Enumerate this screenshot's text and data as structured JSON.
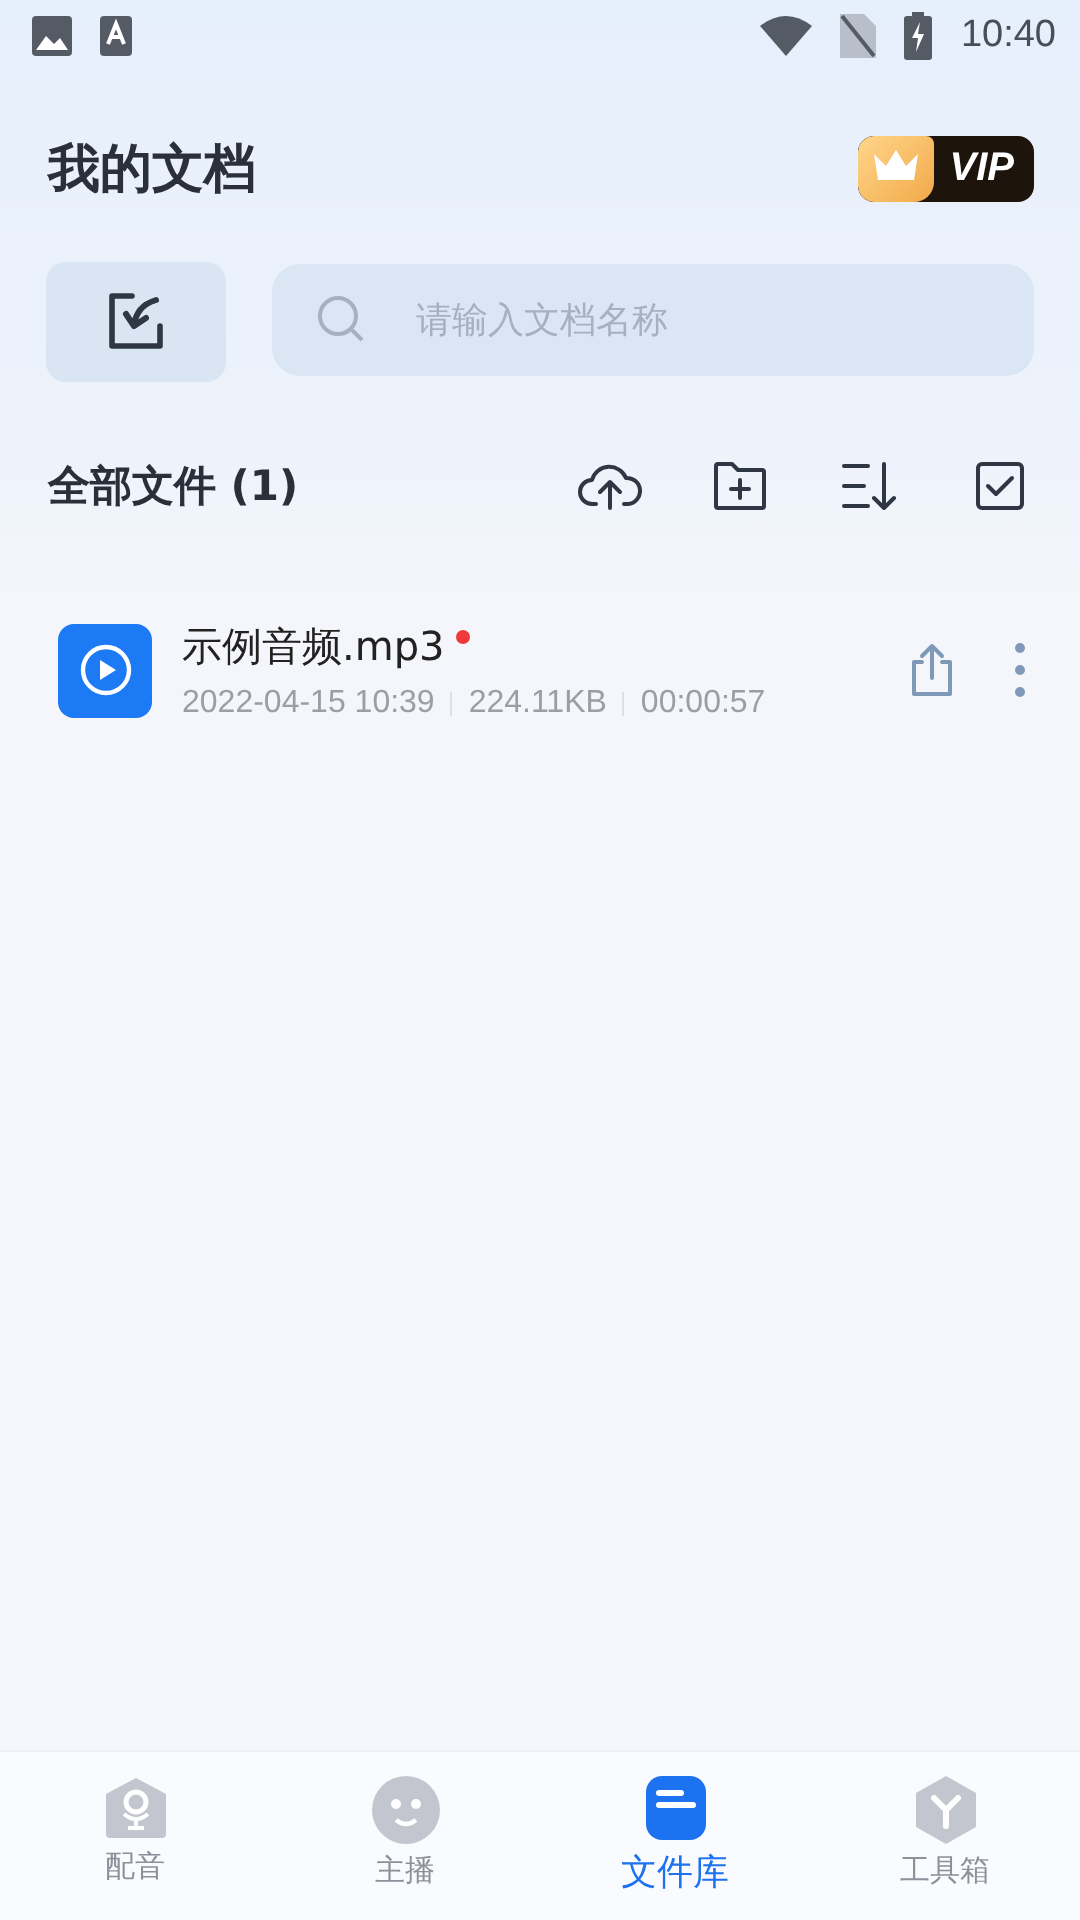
{
  "status_bar": {
    "time": "10:40"
  },
  "header": {
    "title": "我的文档",
    "vip_badge": "VIP"
  },
  "search": {
    "placeholder": "请输入文档名称"
  },
  "section": {
    "title": "全部文件 (1)"
  },
  "files": [
    {
      "name": "示例音频.mp3",
      "new": true,
      "date": "2022-04-15 10:39",
      "size": "224.11KB",
      "duration": "00:00:57"
    }
  ],
  "tabs": [
    {
      "label": "配音",
      "selected": false
    },
    {
      "label": "主播",
      "selected": false
    },
    {
      "label": "文件库",
      "selected": true
    },
    {
      "label": "工具箱",
      "selected": false
    }
  ]
}
